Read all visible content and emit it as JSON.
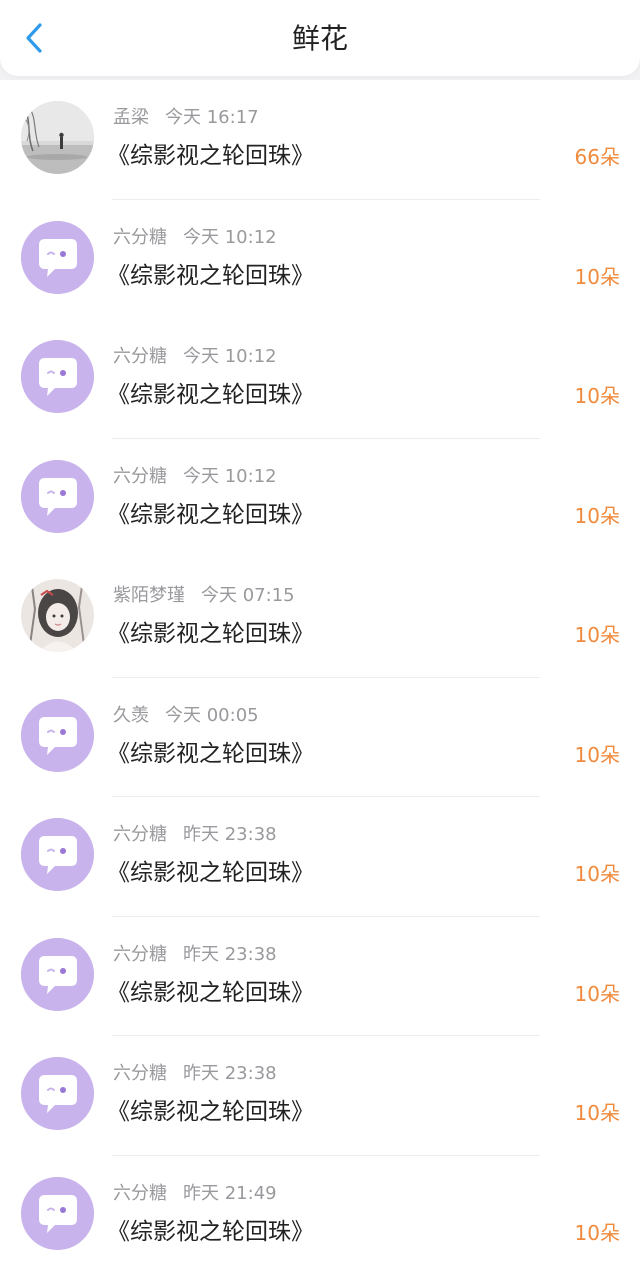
{
  "header": {
    "title": "鲜花",
    "back_icon": "chevron-left-icon",
    "accent_color": "#2f9bea"
  },
  "colors": {
    "count": "#f08a3c",
    "meta": "#9a9a9e",
    "default_avatar": "#c9b3ec"
  },
  "items": [
    {
      "user": "孟梁",
      "time": "今天 16:17",
      "book": "《综影视之轮回珠》",
      "count": "66朵",
      "avatar": "photo-landscape-avatar"
    },
    {
      "user": "六分糖",
      "time": "今天 10:12",
      "book": "《综影视之轮回珠》",
      "count": "10朵",
      "avatar": "default-chat-avatar"
    },
    {
      "user": "六分糖",
      "time": "今天 10:12",
      "book": "《综影视之轮回珠》",
      "count": "10朵",
      "avatar": "default-chat-avatar"
    },
    {
      "user": "六分糖",
      "time": "今天 10:12",
      "book": "《综影视之轮回珠》",
      "count": "10朵",
      "avatar": "default-chat-avatar"
    },
    {
      "user": "紫陌梦瑾",
      "time": "今天 07:15",
      "book": "《综影视之轮回珠》",
      "count": "10朵",
      "avatar": "photo-illustration-avatar"
    },
    {
      "user": "久羡",
      "time": "今天 00:05",
      "book": "《综影视之轮回珠》",
      "count": "10朵",
      "avatar": "default-chat-avatar"
    },
    {
      "user": "六分糖",
      "time": "昨天 23:38",
      "book": "《综影视之轮回珠》",
      "count": "10朵",
      "avatar": "default-chat-avatar"
    },
    {
      "user": "六分糖",
      "time": "昨天 23:38",
      "book": "《综影视之轮回珠》",
      "count": "10朵",
      "avatar": "default-chat-avatar"
    },
    {
      "user": "六分糖",
      "time": "昨天 23:38",
      "book": "《综影视之轮回珠》",
      "count": "10朵",
      "avatar": "default-chat-avatar"
    },
    {
      "user": "六分糖",
      "time": "昨天 21:49",
      "book": "《综影视之轮回珠》",
      "count": "10朵",
      "avatar": "default-chat-avatar"
    }
  ]
}
